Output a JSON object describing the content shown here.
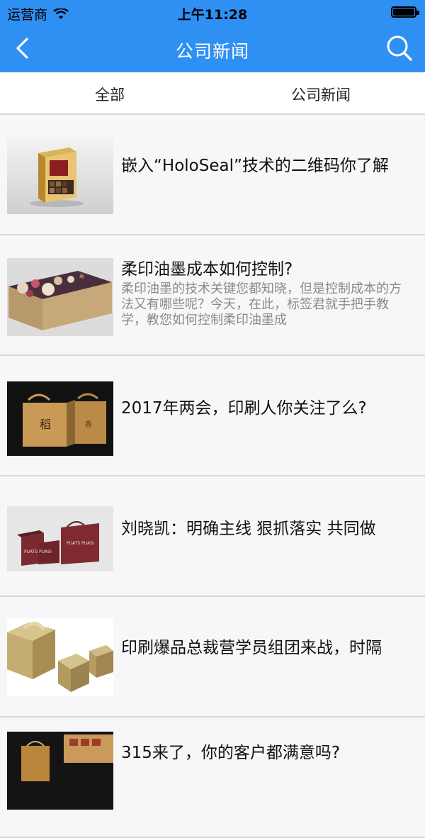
{
  "status": {
    "carrier": "运营商",
    "time": "上午11:28"
  },
  "nav": {
    "title": "公司新闻"
  },
  "tabs": [
    {
      "label": "全部"
    },
    {
      "label": "公司新闻"
    }
  ],
  "articles": [
    {
      "title": "嵌入“HoloSeal”技术的二维码你了解",
      "desc": ""
    },
    {
      "title": "柔印油墨成本如何控制?",
      "desc": "柔印油墨的技术关键您都知晓，但是控制成本的方法又有哪些呢？今天，在此，标签君就手把手教学，教您如何控制柔印油墨成"
    },
    {
      "title": "2017年两会，印刷人你关注了么?",
      "desc": ""
    },
    {
      "title": "刘晓凯：明确主线 狠抓落实 共同做",
      "desc": ""
    },
    {
      "title": "印刷爆品总裁营学员组团来战，时隔",
      "desc": ""
    },
    {
      "title": "315来了，你的客户都满意吗?",
      "desc": ""
    }
  ],
  "thumb_text": {
    "brand": "PUATS PUASI"
  },
  "colors": {
    "accent": "#2f90f3",
    "background": "#f7f7f9"
  }
}
